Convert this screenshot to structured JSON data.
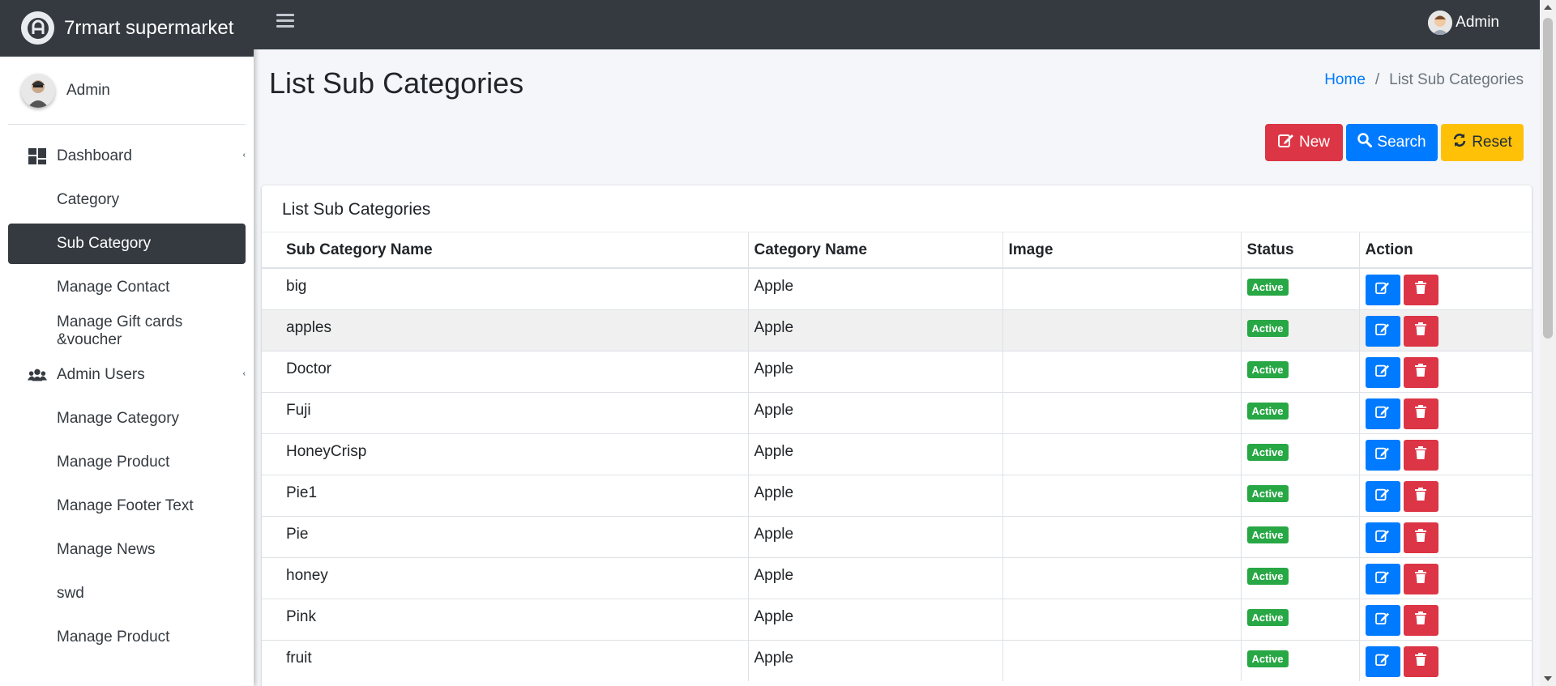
{
  "brand": {
    "name": "7rmart supermarket"
  },
  "user": {
    "name": "Admin"
  },
  "sidebar": {
    "items": [
      {
        "label": "Dashboard",
        "icon": "dashboard-icon",
        "has_children": true
      },
      {
        "label": "Category"
      },
      {
        "label": "Sub Category",
        "active": true
      },
      {
        "label": "Manage Contact"
      },
      {
        "label": "Manage Gift cards &voucher"
      },
      {
        "label": "Admin Users",
        "icon": "users-icon",
        "has_children": true
      },
      {
        "label": "Manage Category"
      },
      {
        "label": "Manage Product"
      },
      {
        "label": "Manage Footer Text"
      },
      {
        "label": "Manage News"
      },
      {
        "label": "swd"
      },
      {
        "label": "Manage Product"
      }
    ]
  },
  "navbar": {
    "user_name": "Admin"
  },
  "page": {
    "title": "List Sub Categories",
    "breadcrumb": {
      "home": "Home",
      "separator": "/",
      "current": "List Sub Categories"
    }
  },
  "toolbar": {
    "new_label": "New",
    "search_label": "Search",
    "reset_label": "Reset"
  },
  "card": {
    "title": "List Sub Categories"
  },
  "table": {
    "columns": [
      "Sub Category Name",
      "Category Name",
      "Image",
      "Status",
      "Action"
    ],
    "rows": [
      {
        "name": "big",
        "category": "Apple",
        "status": "Active"
      },
      {
        "name": "apples",
        "category": "Apple",
        "status": "Active"
      },
      {
        "name": "Doctor",
        "category": "Apple",
        "status": "Active"
      },
      {
        "name": "Fuji",
        "category": "Apple",
        "status": "Active"
      },
      {
        "name": "HoneyCrisp",
        "category": "Apple",
        "status": "Active"
      },
      {
        "name": "Pie1",
        "category": "Apple",
        "status": "Active"
      },
      {
        "name": "Pie",
        "category": "Apple",
        "status": "Active"
      },
      {
        "name": "honey",
        "category": "Apple",
        "status": "Active"
      },
      {
        "name": "Pink",
        "category": "Apple",
        "status": "Active"
      },
      {
        "name": "fruit",
        "category": "Apple",
        "status": "Active"
      }
    ]
  },
  "colors": {
    "sidebar_dark": "#343a40",
    "primary": "#007bff",
    "danger": "#dc3545",
    "warning": "#ffc107",
    "success": "#28a745"
  }
}
